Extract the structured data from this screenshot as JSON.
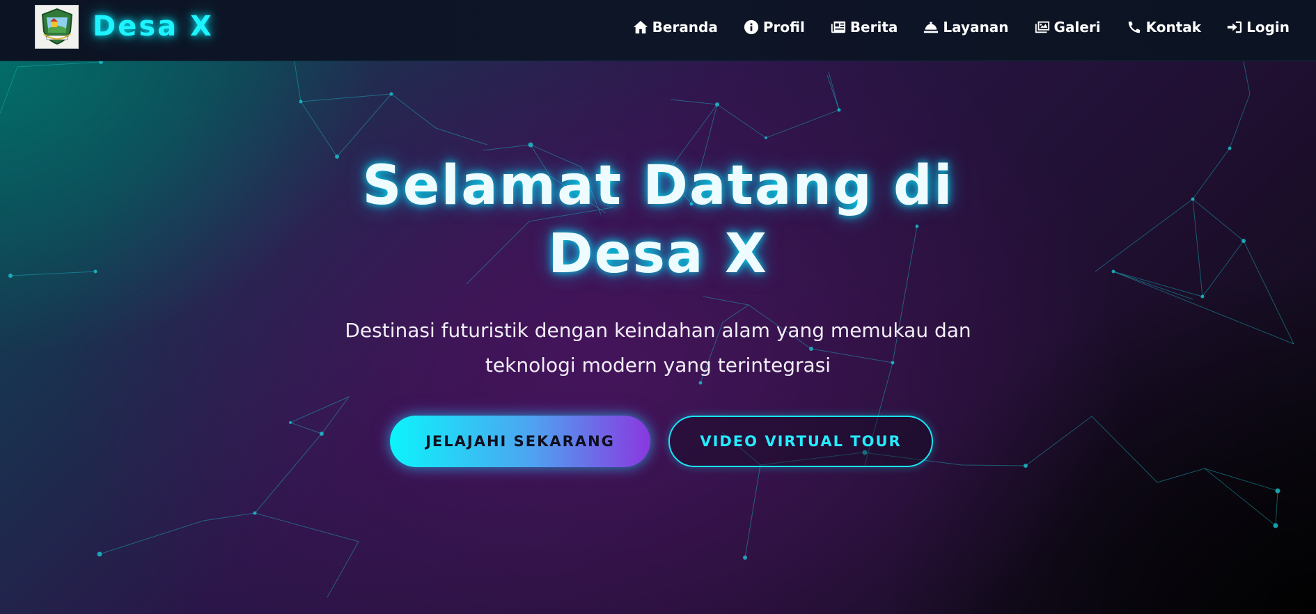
{
  "brand": {
    "name": "Desa X",
    "logo_icon": "village-crest-icon",
    "accent_color": "#1ef4ff"
  },
  "nav": {
    "items": [
      {
        "label": "Beranda",
        "icon": "home-icon"
      },
      {
        "label": "Profil",
        "icon": "info-circle-icon"
      },
      {
        "label": "Berita",
        "icon": "newspaper-icon"
      },
      {
        "label": "Layanan",
        "icon": "concierge-bell-icon"
      },
      {
        "label": "Galeri",
        "icon": "images-icon"
      },
      {
        "label": "Kontak",
        "icon": "phone-icon"
      },
      {
        "label": "Login",
        "icon": "sign-in-icon"
      }
    ]
  },
  "hero": {
    "title_line1": "Selamat Datang di",
    "title_line2": "Desa X",
    "subtitle_line1": "Destinasi futuristik dengan keindahan alam yang memukau dan",
    "subtitle_line2": "teknologi modern yang terintegrasi",
    "primary_button": "JELAJAHI SEKARANG",
    "secondary_button": "VIDEO VIRTUAL TOUR"
  }
}
